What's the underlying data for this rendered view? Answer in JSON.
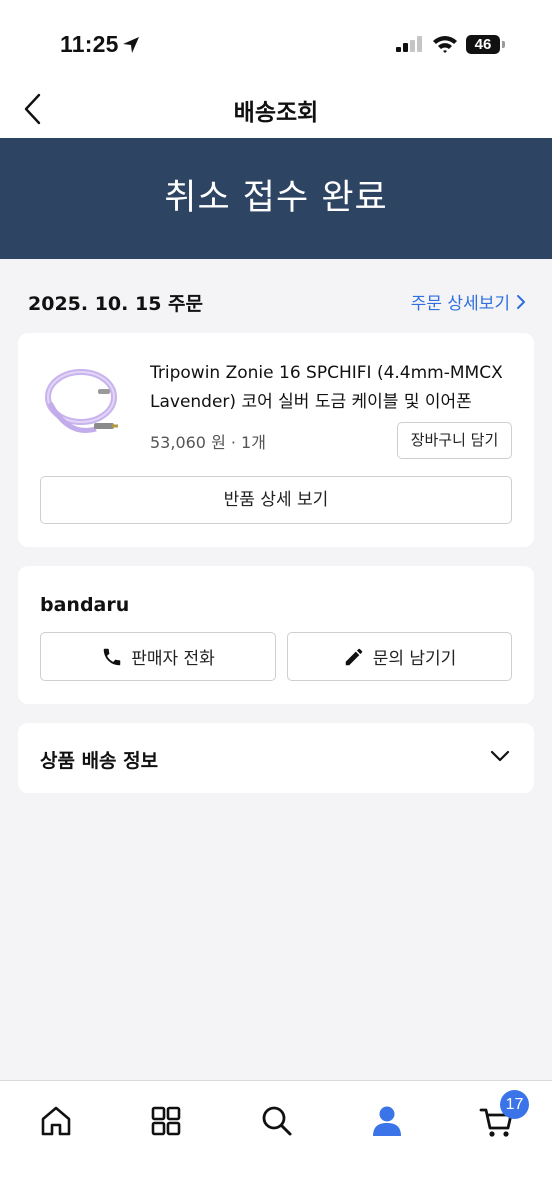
{
  "status_bar": {
    "time": "11:25",
    "battery": "46"
  },
  "nav": {
    "title": "배송조회"
  },
  "banner": {
    "text": "취소 접수 완료",
    "color": "#2d4463"
  },
  "order": {
    "date_label": "2025. 10. 15 주문",
    "detail_link": "주문 상세보기"
  },
  "product": {
    "name": "Tripowin Zonie 16 SPCHIFI (4.4mm-MMCX Lavender) 코어 실버 도금 케이블 및 이어폰",
    "price_qty": "53,060 원 · 1개",
    "cart_button": "장바구니 담기",
    "return_button": "반품 상세 보기"
  },
  "seller": {
    "name": "bandaru",
    "call_button": "판매자 전화",
    "inquiry_button": "문의 남기기"
  },
  "shipping": {
    "title": "상품 배송 정보"
  },
  "tabbar": {
    "items": [
      "home-icon",
      "grid-icon",
      "search-icon",
      "profile-icon",
      "cart-icon"
    ],
    "active": "profile-icon",
    "active_color": "#3b74e8",
    "cart_badge": "17"
  },
  "colors": {
    "accent": "#2f6fe0",
    "banner_bg": "#2d4463"
  }
}
